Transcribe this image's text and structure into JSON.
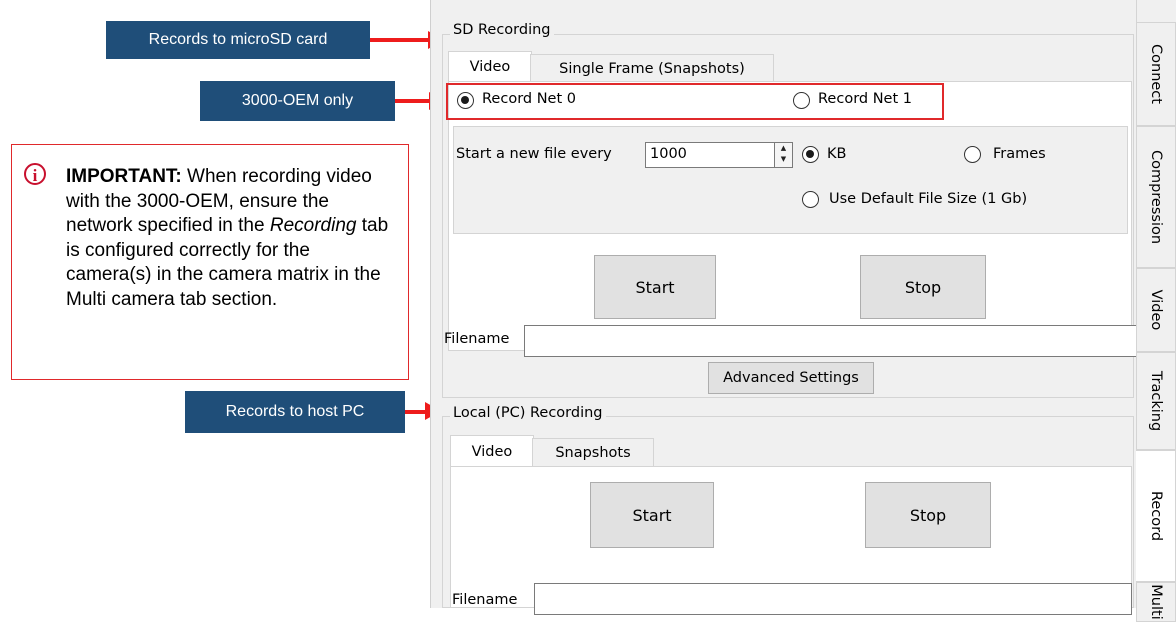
{
  "callouts": {
    "sd": "Records to microSD card",
    "oem": "3000-OEM only",
    "host": "Records to host PC"
  },
  "note": {
    "icon": "info-icon",
    "bold": "IMPORTANT:",
    "text1": " When recording video with the 3000-OEM, ensure the network specified in the ",
    "italic": "Recording",
    "text2": " tab is configured correctly for the camera(s) in the camera matrix in the Multi camera tab section."
  },
  "sd": {
    "title": "SD Recording",
    "tabs": [
      "Video",
      "Single Frame (Snapshots)"
    ],
    "net0": "Record Net 0",
    "net1": "Record Net 1",
    "new_file_label": "Start a new file every",
    "new_file_value": "1000",
    "kb": "KB",
    "frames": "Frames",
    "default_size": "Use Default File Size (1 Gb)",
    "start": "Start",
    "stop": "Stop",
    "filename_label": "Filename",
    "filename_value": "",
    "advanced": "Advanced Settings"
  },
  "local": {
    "title": "Local (PC) Recording",
    "tabs": [
      "Video",
      "Snapshots"
    ],
    "start": "Start",
    "stop": "Stop",
    "filename_label": "Filename",
    "filename_value": ""
  },
  "side_tabs": [
    "Connect",
    "Compression",
    "Video",
    "Tracking",
    "Record",
    "Multi"
  ],
  "colors": {
    "callout": "#1f4e79",
    "arrow": "#ee1c1c",
    "highlight": "#e0292b"
  }
}
